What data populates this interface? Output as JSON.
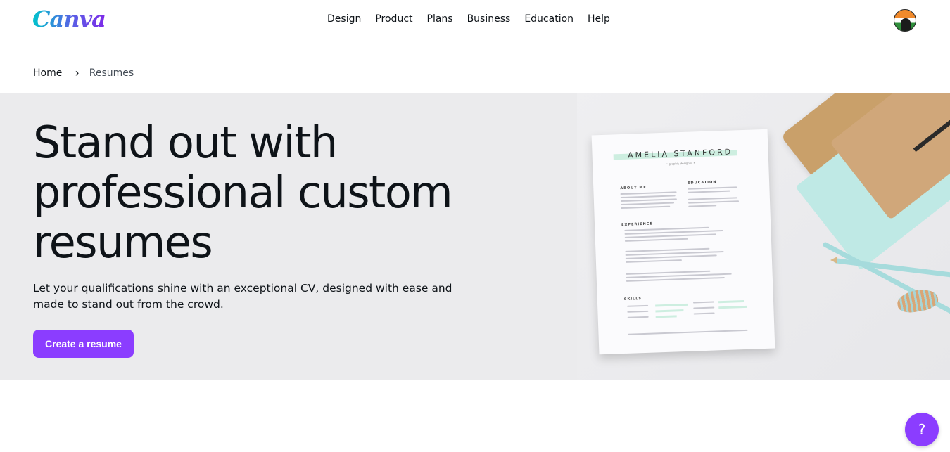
{
  "header": {
    "logo_text": "Canva",
    "nav": [
      "Design",
      "Product",
      "Plans",
      "Business",
      "Education",
      "Help"
    ]
  },
  "breadcrumb": {
    "home": "Home",
    "current": "Resumes"
  },
  "hero": {
    "title": "Stand out with professional custom resumes",
    "description": "Let your qualifications shine with an exceptional CV, designed with ease and made to stand out from the crowd.",
    "cta_label": "Create a resume",
    "resume_preview": {
      "name": "AMELIA STANFORD",
      "subtitle": "• graphic designer •",
      "sections": [
        "ABOUT ME",
        "EDUCATION",
        "EXPERIENCE",
        "SKILLS"
      ]
    }
  },
  "help_button": {
    "label": "?"
  },
  "colors": {
    "accent": "#8b3dff",
    "hero_bg": "#ebebed",
    "text": "#0e1318"
  }
}
